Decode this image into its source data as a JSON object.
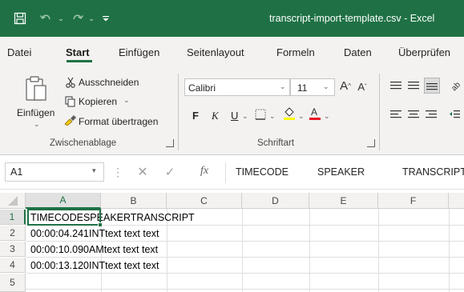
{
  "window": {
    "title": "transcript-import-template.csv - Excel"
  },
  "tabs": [
    "Datei",
    "Start",
    "Einfügen",
    "Seitenlayout",
    "Formeln",
    "Daten",
    "Überprüfen"
  ],
  "ribbon": {
    "clipboard": {
      "paste_label": "Einfügen",
      "cut_label": "Ausschneiden",
      "copy_label": "Kopieren",
      "format_painter_label": "Format übertragen",
      "group_label": "Zwischenablage"
    },
    "font": {
      "font_name": "Calibri",
      "font_size": "11",
      "bold": "F",
      "italic": "K",
      "underline": "U",
      "group_label": "Schriftart"
    }
  },
  "formula_bar": {
    "name_box": "A1",
    "fx": "fx",
    "content": [
      "TIMECODE",
      "SPEAKER",
      "TRANSCRIPT"
    ]
  },
  "grid": {
    "columns": [
      "A",
      "B",
      "C",
      "D",
      "E",
      "F"
    ],
    "rows": [
      "1",
      "2",
      "3",
      "4",
      "5"
    ],
    "cells": [
      "TIMECODESPEAKERTRANSCRIPT",
      "00:00:04.241INTtext text text",
      "00:00:10.090AMtext text text",
      "00:00:13.120INTtext text text",
      ""
    ]
  },
  "colors": {
    "brand": "#1f7145",
    "ribbon_bg": "#f3f2f1"
  }
}
